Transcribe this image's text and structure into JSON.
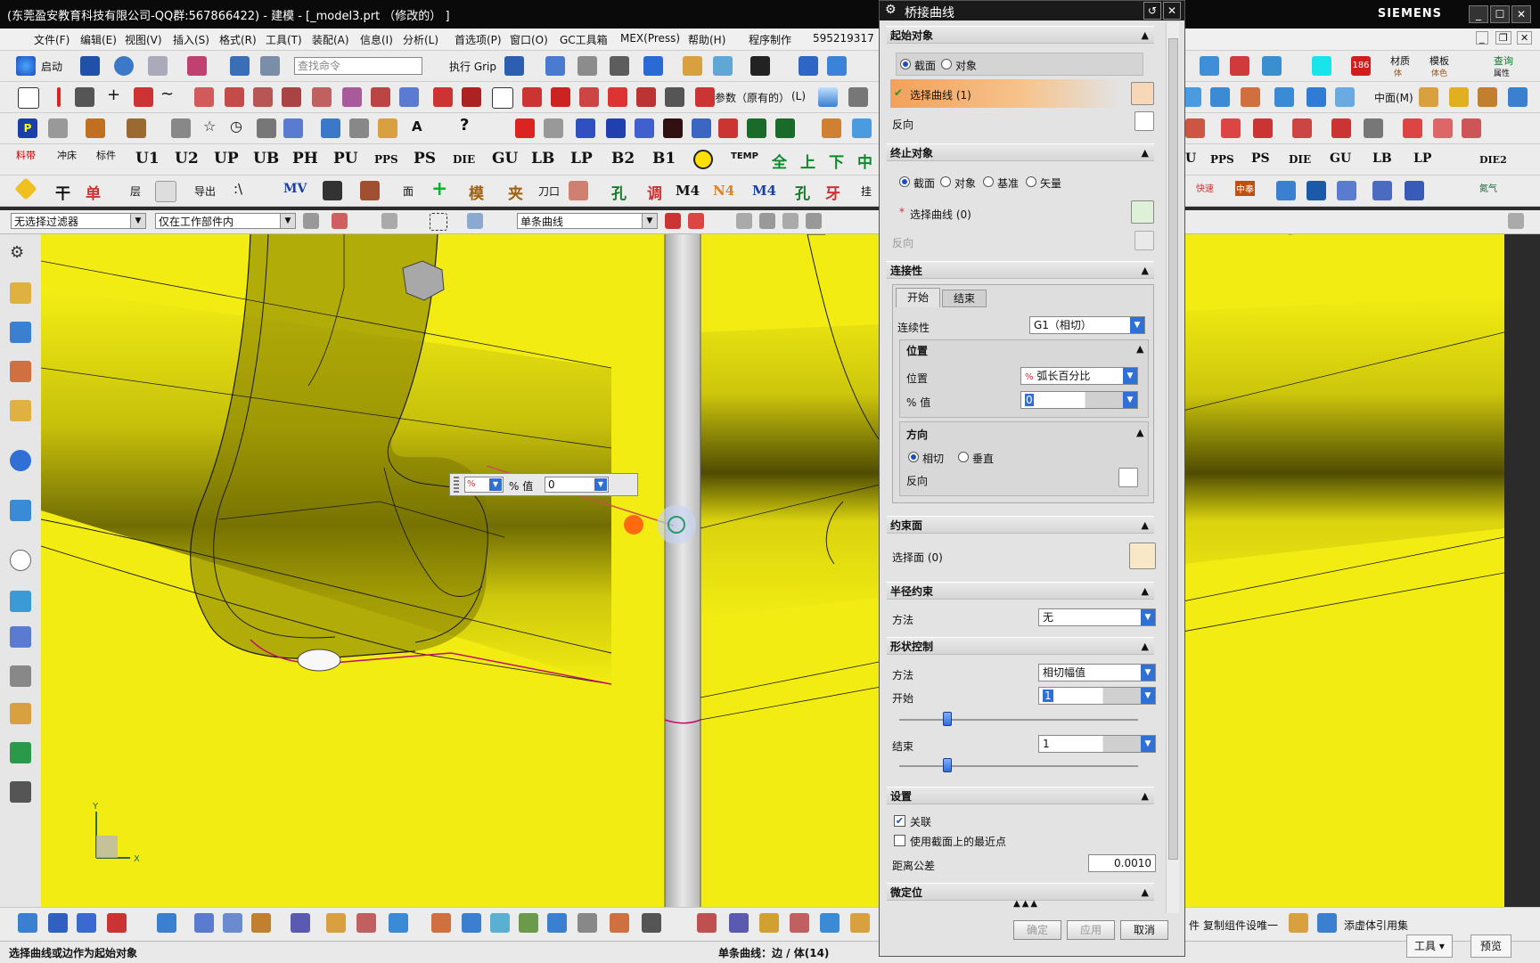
{
  "window": {
    "title": "(东莞盈安教育科技有限公司-QQ群:567866422) - 建模 - [_model3.prt （修改的） ]",
    "brand": "SIEMENS",
    "win_buttons": [
      "_",
      "☐",
      "✕"
    ]
  },
  "menu": {
    "items": [
      "文件(F)",
      "编辑(E)",
      "视图(V)",
      "插入(S)",
      "格式(R)",
      "工具(T)",
      "装配(A)",
      "信息(I)",
      "分析(L)",
      "首选项(P)",
      "窗口(O)",
      "GC工具箱",
      "MEX(Press)",
      "帮助(H)",
      "程序制作",
      "595219317"
    ]
  },
  "toolbar1": {
    "start": "启动",
    "search_placeholder": "查找命令",
    "grip": "执行 Grip",
    "material": "材质",
    "material_sub": "体",
    "template": "模板",
    "template_sub": "体色",
    "query": "查询",
    "query_sub": "属性",
    "badge": "186"
  },
  "toolbar2": {
    "params": "参数（原有的）",
    "params_suffix": "(L)",
    "mid": "中面(M)"
  },
  "toolbar4": {
    "labels": [
      "U1",
      "U2",
      "UP",
      "UB",
      "PH",
      "PU",
      "PPS",
      "PS",
      "DIE",
      "GU",
      "LB",
      "LP",
      "B2",
      "B1"
    ],
    "small1": "料带",
    "small2": "冲床",
    "small3": "标件",
    "temp": "TEMP",
    "quan": "全",
    "shang": "上",
    "xia": "下",
    "zhong": "中",
    "right": [
      "U",
      "PPS",
      "PS",
      "DIE",
      "GU",
      "LB",
      "LP",
      "DIE2"
    ]
  },
  "toolbar5": {
    "gan": "干",
    "dan": "单",
    "ceng": "层",
    "export": "导出",
    "path": ":\\",
    "mv": "MV",
    "mian": "面",
    "mo": "模",
    "jia": "夹",
    "daokou": "刀口",
    "kong": "孔",
    "tiao": "调",
    "m4": "M4",
    "n4": "N4",
    "kong2": "孔",
    "ya": "牙",
    "ji": "挂",
    "right1": "快速",
    "right2": "中奉",
    "right3": "氮气"
  },
  "filterbar": {
    "filter": "无选择过滤器",
    "scope": "仅在工作部件内",
    "curve_rule": "单条曲线"
  },
  "viewport": {
    "popup_label": "% 值",
    "popup_value": "0",
    "axis_x": "X",
    "axis_y": "Y"
  },
  "bottomtb": {
    "copy_component": "复制组件设唯一",
    "add_to_ref": "添虚体引用集",
    "right_label": "件"
  },
  "status": {
    "left": "选择曲线或边作为起始对象",
    "mid": "单条曲线：边 / 体(14)",
    "tools": "工具",
    "preview": "预览"
  },
  "dialog": {
    "title": "桥接曲线",
    "start_section": "起始对象",
    "start_radio1": "截面",
    "start_radio2": "对象",
    "start_select": "选择曲线 (1)",
    "start_reverse": "反向",
    "end_section": "终止对象",
    "end_radio1": "截面",
    "end_radio2": "对象",
    "end_radio3": "基准",
    "end_radio4": "矢量",
    "end_select": "选择曲线 (0)",
    "end_reverse": "反向",
    "conn_section": "连接性",
    "tab_start": "开始",
    "tab_end": "结束",
    "continuity_label": "连续性",
    "continuity_value": "G1（相切）",
    "pos_section": "位置",
    "pos_label": "位置",
    "pos_value": "弧长百分比",
    "pct_label": "% 值",
    "pct_value": "0",
    "dir_section": "方向",
    "dir_radio1": "相切",
    "dir_radio2": "垂直",
    "dir_reverse": "反向",
    "constraint_section": "约束面",
    "select_face": "选择面 (0)",
    "radius_section": "半径约束",
    "radius_method_label": "方法",
    "radius_method_value": "无",
    "shape_section": "形状控制",
    "shape_method_label": "方法",
    "shape_method_value": "相切幅值",
    "shape_start_label": "开始",
    "shape_start_value": "1",
    "shape_start_slider": 0.2,
    "shape_end_label": "结束",
    "shape_end_value": "1",
    "shape_end_slider": 0.2,
    "settings_section": "设置",
    "assoc": "关联",
    "nearest": "使用截面上的最近点",
    "tol_label": "距离公差",
    "tol_value": "0.0010",
    "fine_section": "微定位",
    "ok": "确定",
    "apply": "应用",
    "cancel": "取消"
  },
  "colors": {
    "viewport_yellow": "#f2ec12",
    "dialog_bg": "#e3e3e3",
    "selected_row": "#f2a15b",
    "accent_blue": "#2f6fd6"
  }
}
